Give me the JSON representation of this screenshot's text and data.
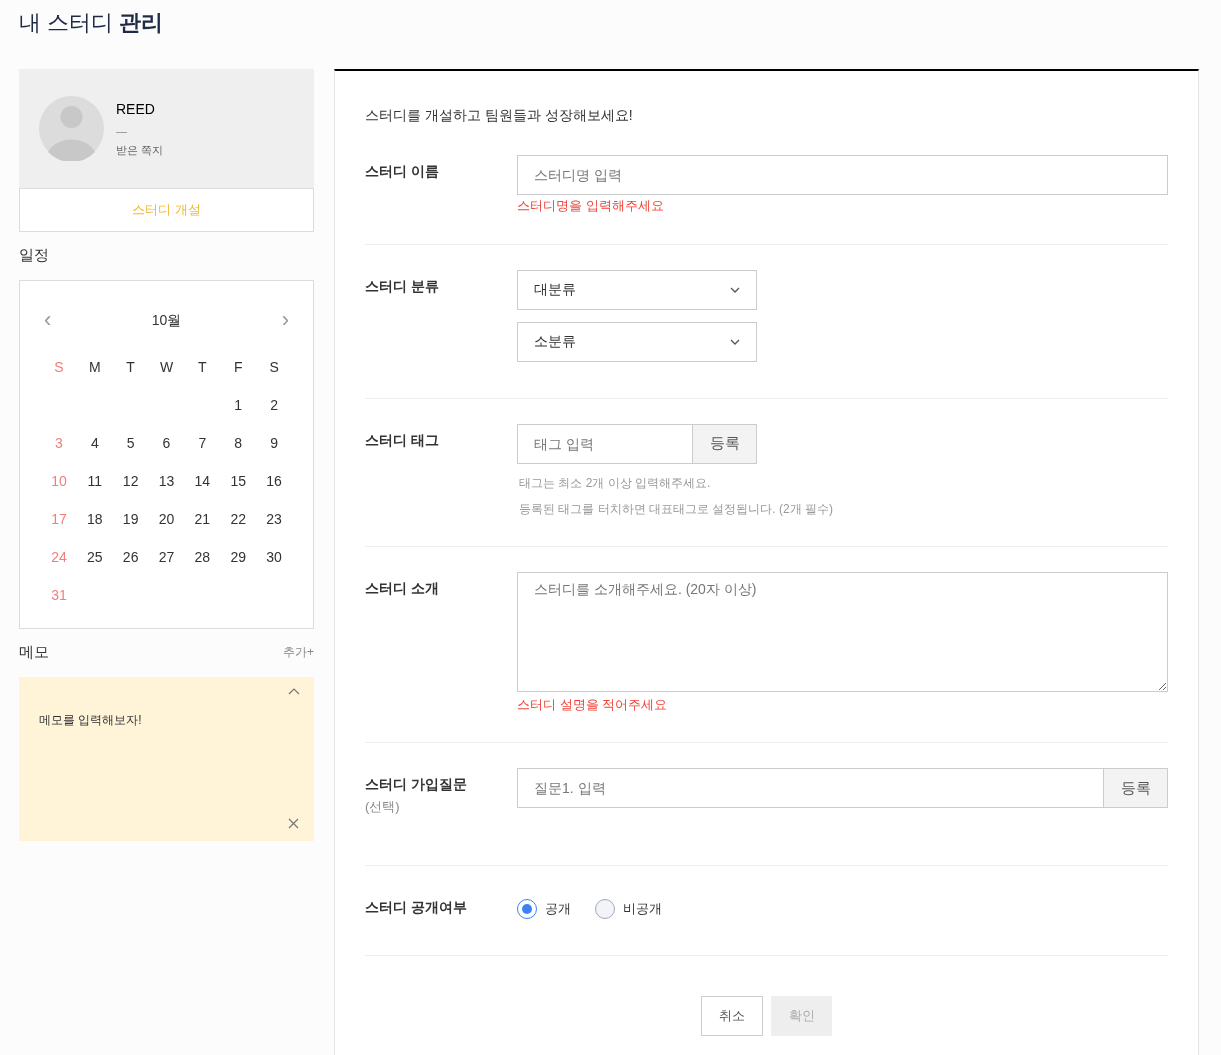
{
  "page_title": "내 스터디 **관리**",
  "profile": {
    "name": "REED",
    "status": "—",
    "messages_link": "받은 쪽지",
    "open_study_button": "스터디 개설"
  },
  "schedule": {
    "heading": "일정",
    "prev": "‹",
    "month": "10월",
    "next": "›",
    "weekdays": [
      {
        "label": "S",
        "holiday": true
      },
      {
        "label": "M",
        "holiday": false
      },
      {
        "label": "T",
        "holiday": false
      },
      {
        "label": "W",
        "holiday": false
      },
      {
        "label": "T",
        "holiday": false
      },
      {
        "label": "F",
        "holiday": false
      },
      {
        "label": "S",
        "holiday": false
      }
    ],
    "weeks": [
      [
        {
          "kind": "blank"
        },
        {
          "kind": "blank"
        },
        {
          "kind": "blank"
        },
        {
          "kind": "blank"
        },
        {
          "kind": "blank"
        },
        {
          "kind": "day",
          "label": "1",
          "holiday": false
        },
        {
          "kind": "day",
          "label": "2",
          "holiday": false
        }
      ],
      [
        {
          "kind": "day",
          "label": "3",
          "holiday": true
        },
        {
          "kind": "day",
          "label": "4",
          "holiday": false
        },
        {
          "kind": "day",
          "label": "5",
          "holiday": false
        },
        {
          "kind": "day",
          "label": "6",
          "holiday": false
        },
        {
          "kind": "day",
          "label": "7",
          "holiday": false
        },
        {
          "kind": "day",
          "label": "8",
          "holiday": false
        },
        {
          "kind": "day",
          "label": "9",
          "holiday": false
        }
      ],
      [
        {
          "kind": "day",
          "label": "10",
          "holiday": true
        },
        {
          "kind": "day",
          "label": "11",
          "holiday": false
        },
        {
          "kind": "day",
          "label": "12",
          "holiday": false
        },
        {
          "kind": "day",
          "label": "13",
          "holiday": false
        },
        {
          "kind": "day",
          "label": "14",
          "holiday": false
        },
        {
          "kind": "day",
          "label": "15",
          "holiday": false
        },
        {
          "kind": "day",
          "label": "16",
          "holiday": false
        }
      ],
      [
        {
          "kind": "day",
          "label": "17",
          "holiday": true
        },
        {
          "kind": "day",
          "label": "18",
          "holiday": false
        },
        {
          "kind": "day",
          "label": "19",
          "holiday": false
        },
        {
          "kind": "day",
          "label": "20",
          "holiday": false
        },
        {
          "kind": "day",
          "label": "21",
          "holiday": false
        },
        {
          "kind": "day",
          "label": "22",
          "holiday": false
        },
        {
          "kind": "day",
          "label": "23",
          "holiday": false
        }
      ],
      [
        {
          "kind": "day",
          "label": "24",
          "holiday": true
        },
        {
          "kind": "day",
          "label": "25",
          "holiday": false
        },
        {
          "kind": "day",
          "label": "26",
          "holiday": false
        },
        {
          "kind": "day",
          "label": "27",
          "holiday": false
        },
        {
          "kind": "day",
          "label": "28",
          "holiday": false
        },
        {
          "kind": "day",
          "label": "29",
          "holiday": false
        },
        {
          "kind": "day",
          "label": "30",
          "holiday": false
        }
      ],
      [
        {
          "kind": "day",
          "label": "31",
          "holiday": true
        }
      ]
    ]
  },
  "memo": {
    "heading": "메모",
    "add_button": "추가+",
    "note": "메모를 입력해보자!"
  },
  "form": {
    "intro": "스터디를 개설하고 팀원들과 성장해보세요!",
    "sections": [
      {
        "kind": "text",
        "label": "스터디 이름",
        "placeholder": "스터디명 입력",
        "error": "스터디명을 입력해주세요"
      },
      {
        "kind": "selects",
        "label": "스터디 분류",
        "selects": [
          "대분류",
          "소분류"
        ]
      },
      {
        "kind": "tag",
        "label": "스터디 태그",
        "placeholder": "태그 입력",
        "button": "등록",
        "hints": [
          "태그는 최소 2개 이상 입력해주세요.",
          "등록된 태그를 터치하면 대표태그로 설정됩니다. (2개 필수)"
        ]
      },
      {
        "kind": "textarea",
        "label": "스터디 소개",
        "placeholder": "스터디를 소개해주세요. (20자 이상)",
        "error": "스터디 설명을 적어주세요"
      },
      {
        "kind": "question",
        "label": "스터디 가입질문",
        "sublabel": "(선택)",
        "placeholder": "질문1. 입력",
        "button": "등록"
      },
      {
        "kind": "radio",
        "label": "스터디 공개여부",
        "options": [
          {
            "label": "공개",
            "selected": true
          },
          {
            "label": "비공개",
            "selected": false
          }
        ]
      }
    ],
    "cancel_button": "취소",
    "confirm_button": "확인",
    "confirm_disabled": true
  }
}
